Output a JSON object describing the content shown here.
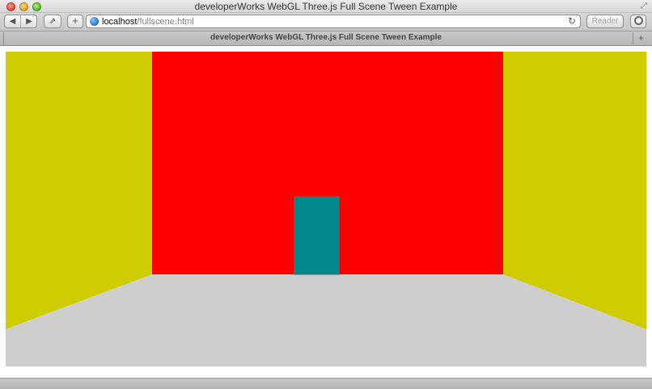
{
  "window": {
    "title": "developerWorks WebGL Three.js Full Scene Tween Example"
  },
  "toolbar": {
    "back_icon": "◀",
    "forward_icon": "▶",
    "share_icon": "⇗",
    "add_icon": "+",
    "url_host": "localhost",
    "url_path": "/fullscene.html",
    "reload_icon": "↻",
    "reader_label": "Reader"
  },
  "tabs": [
    {
      "title": "developerWorks WebGL Three.js Full Scene Tween Example"
    }
  ],
  "tabbar": {
    "new_tab_icon": "+"
  },
  "scene": {
    "colors": {
      "side_walls": "#cfcc00",
      "back_wall": "#ff0000",
      "floor": "#cecece",
      "door": "#00888a"
    }
  }
}
